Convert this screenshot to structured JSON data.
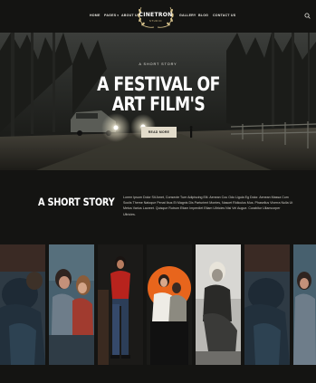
{
  "header": {
    "nav_left": [
      {
        "label": "HOME"
      },
      {
        "label": "PAGES"
      },
      {
        "label": "ABOUT US"
      }
    ],
    "nav_right": [
      {
        "label": "GALLERY"
      },
      {
        "label": "BLOG"
      },
      {
        "label": "CONTACT US"
      }
    ],
    "logo": {
      "name": "CINETRON",
      "tagline": "STUDIO"
    },
    "search_icon": "search-icon"
  },
  "hero": {
    "eyebrow": "A SHORT STORY",
    "title_line1": "A FESTIVAL OF",
    "title_line2": "ART FILM'S",
    "button_label": "READ MORE"
  },
  "story": {
    "heading": "A SHORT STORY",
    "text": "Lorem Ipsum Dolor Sit Amet, Consecte Tuer Adipiscing Elit. Aenean Cou Odo Ligula Eg Dolor. Aenean Massa Cum Sociis Theme Natoque Penat Ibus Et Magnis Dis Parturient Montes, Nascet Ridiculus Mus. Phasellus Viverra Nulla Ut Metus Varius Laoreet. Quisque Rutrum Etiam Imperdiet Etiam Ultricies Nisi Vel Augue. Curabitur Ullamcorper Ultricies."
  },
  "gallery": {
    "photos": [
      "photo-1",
      "photo-2",
      "photo-3",
      "photo-4",
      "photo-5",
      "photo-6",
      "photo-7",
      "photo-8",
      "photo-9"
    ]
  },
  "colors": {
    "background": "#141412",
    "accent_gold": "#d9c48c",
    "button_bg": "#e3dccb",
    "orange": "#e8651c"
  }
}
